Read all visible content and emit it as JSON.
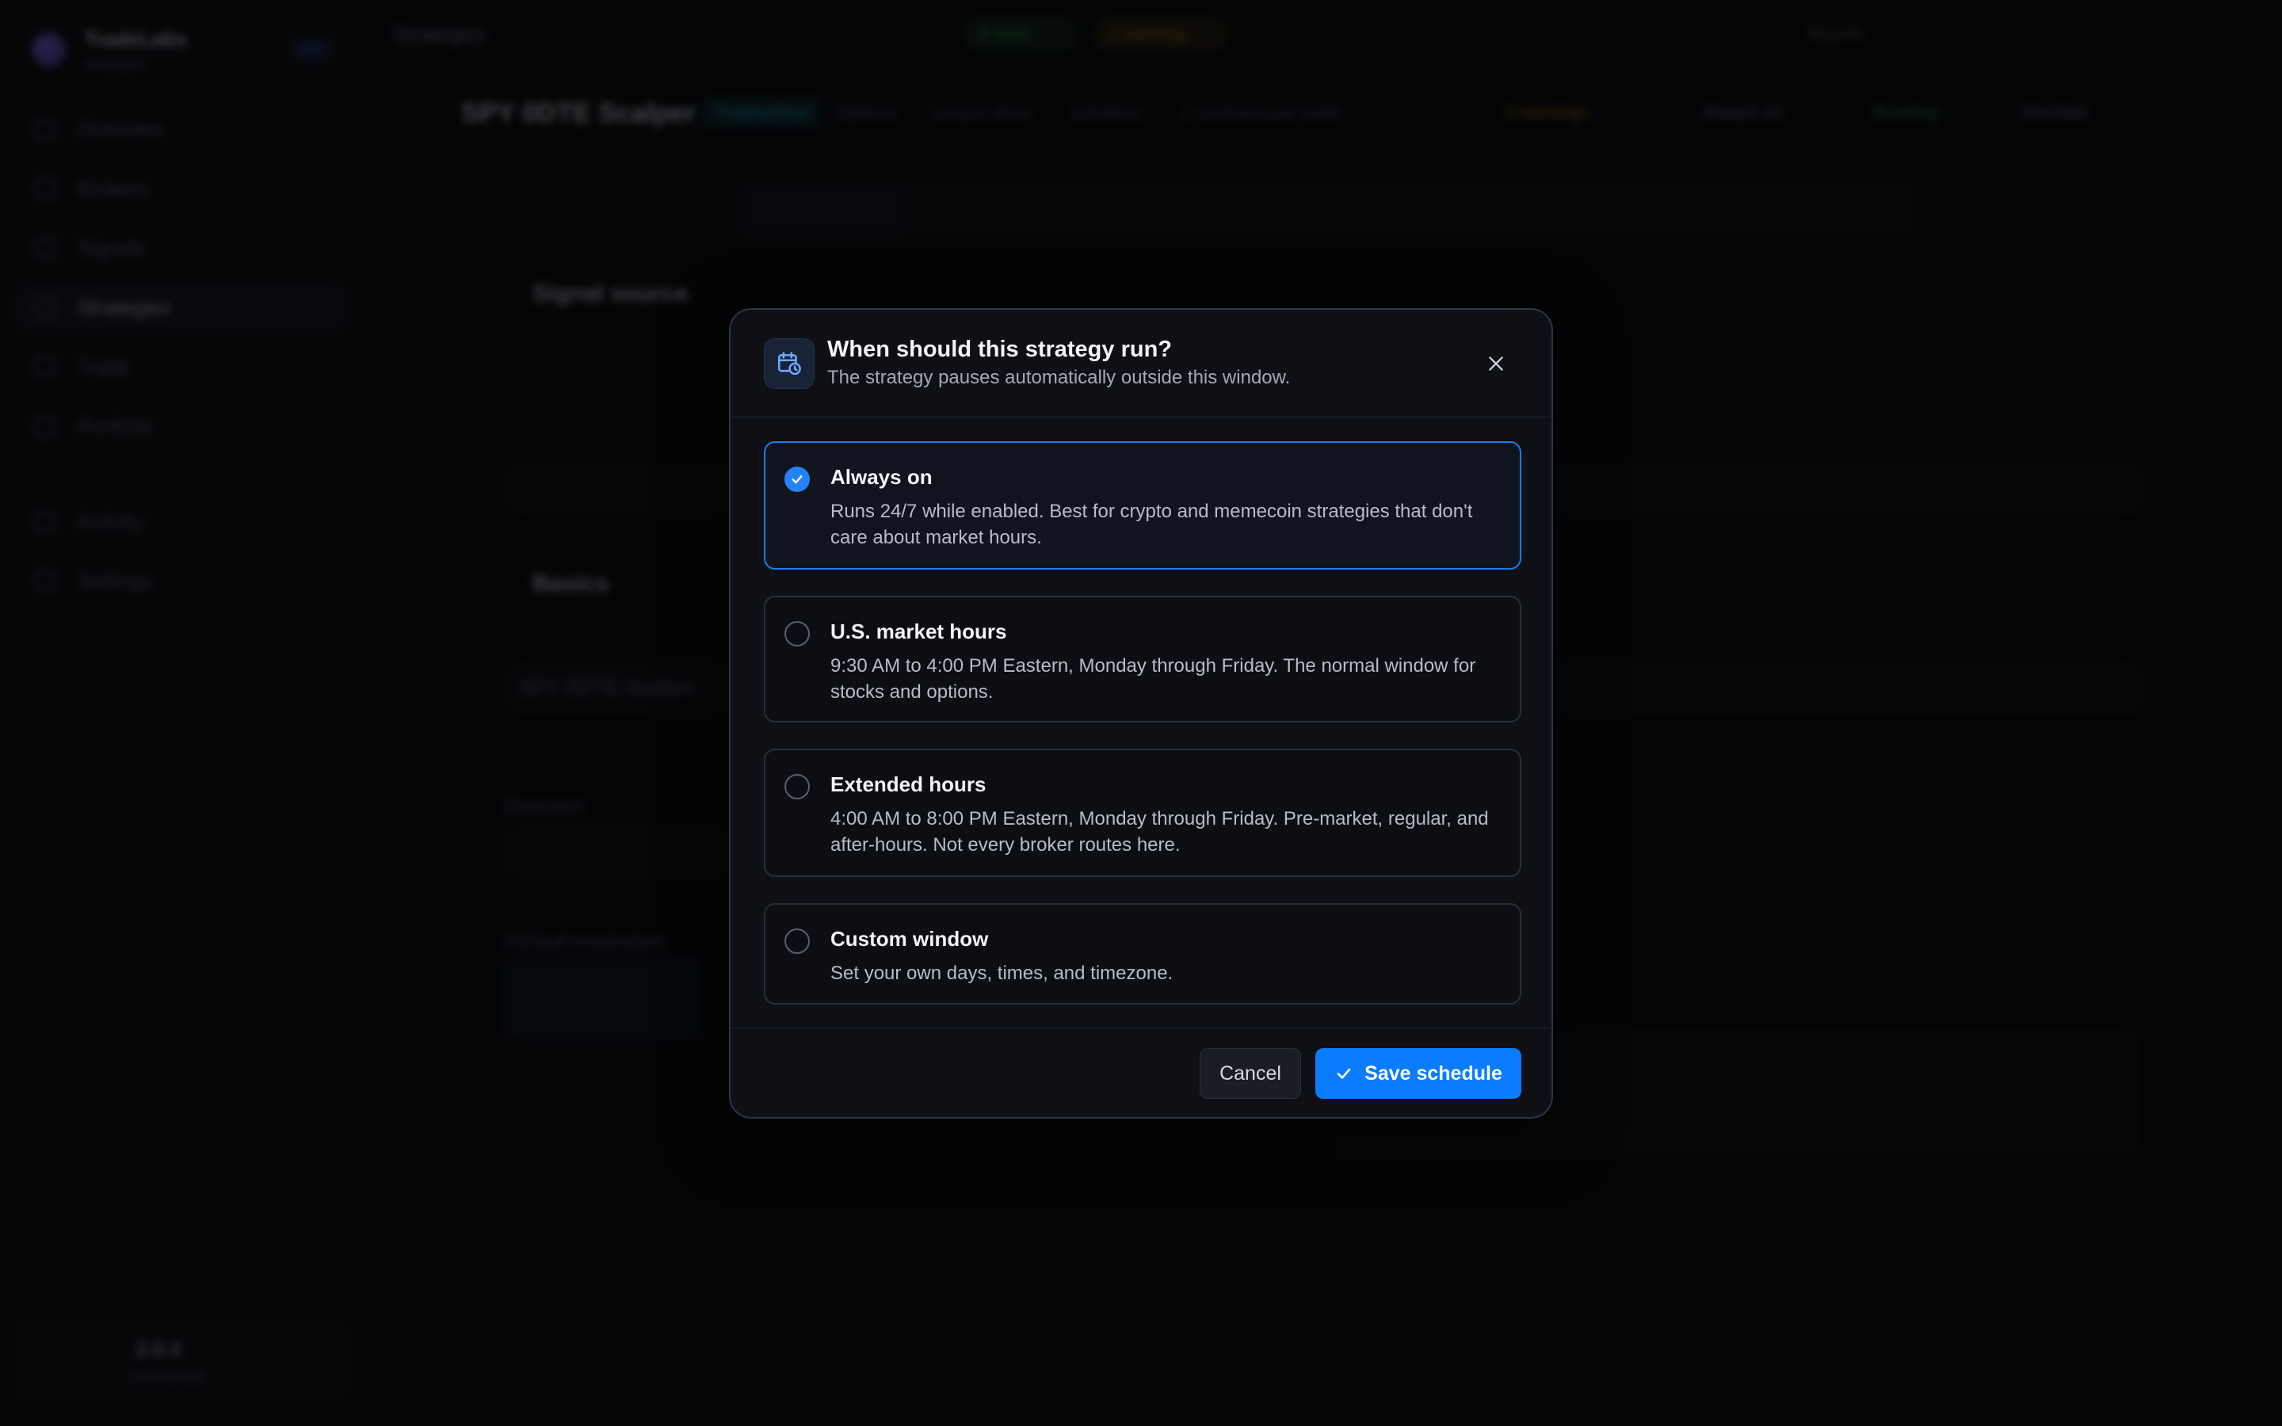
{
  "app": {
    "brand_name": "TradeLabs",
    "brand_sub": "strategies",
    "brand_badge": "pro",
    "nav": [
      "Overview",
      "Brokers",
      "Signals",
      "Strategies",
      "Trade",
      "Portfolio",
      "Activity",
      "Settings"
    ],
    "version": "2.0.0",
    "connection": "Connected"
  },
  "topbar": {
    "title": "Strategies",
    "pill_green": "8 tools",
    "pill_amber": "2 warning",
    "search": "Search"
  },
  "strategy": {
    "name": "SPY 0DTE Scalper",
    "tag": "TradingView",
    "meta": [
      "Options",
      "Long & short",
      "3 brokers",
      "2 contracts per trade"
    ],
    "buttons": [
      "2 warnings",
      "Always on",
      "Running",
      "Simulate"
    ]
  },
  "background": {
    "signal_source": "Signal source",
    "basics": "Basics",
    "name_value": "SPY 0DTE Scalper",
    "direction": "Direction",
    "default_expiration": "Default expiration"
  },
  "modal": {
    "title": "When should this strategy run?",
    "subtitle": "The strategy pauses automatically outside this window.",
    "options": [
      {
        "title": "Always on",
        "description": "Runs 24/7 while enabled. Best for crypto and memecoin strategies that don't care about market hours.",
        "selected": true
      },
      {
        "title": "U.S. market hours",
        "description": "9:30 AM to 4:00 PM Eastern, Monday through Friday. The normal window for stocks and options.",
        "selected": false
      },
      {
        "title": "Extended hours",
        "description": "4:00 AM to 8:00 PM Eastern, Monday through Friday. Pre-market, regular, and after-hours. Not every broker routes here.",
        "selected": false
      },
      {
        "title": "Custom window",
        "description": "Set your own days, times, and timezone.",
        "selected": false
      }
    ],
    "cancel_label": "Cancel",
    "save_label": "Save schedule"
  },
  "colors": {
    "accent": "#0a7cff",
    "selected_border": "#1c7aec",
    "modal_bg": "#0e1016"
  }
}
